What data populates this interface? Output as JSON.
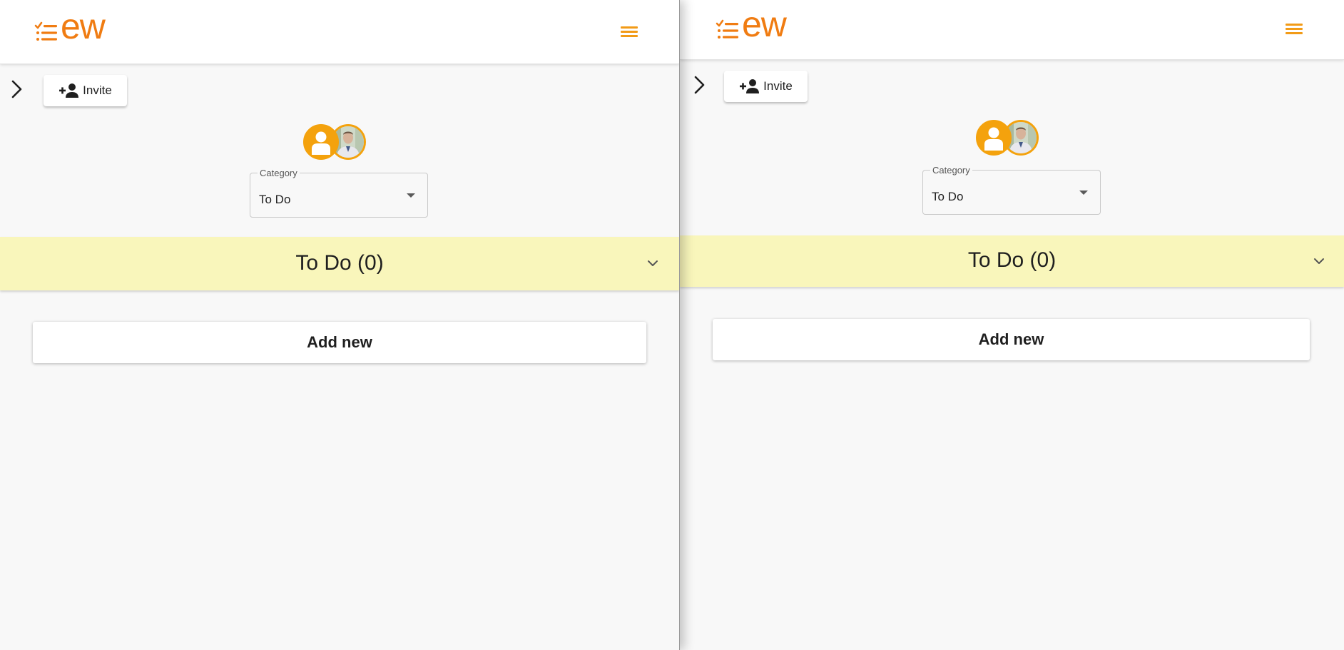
{
  "brand": {
    "logo_text": "ew",
    "logo_color": "#f07c12",
    "accent": "#f4a20d"
  },
  "left_pane": {
    "menu_icon": "hamburger-menu-icon",
    "sidebar_toggle_icon": "chevron-right-icon",
    "invite_label": "Invite",
    "invite_icon": "person-add-icon",
    "avatars": [
      {
        "type": "default-user",
        "icon": "user-icon"
      },
      {
        "type": "photo",
        "icon": "user-photo"
      }
    ],
    "category": {
      "legend": "Category",
      "value": "To Do"
    },
    "section": {
      "title": "To Do (0)",
      "color": "#f9f6bb",
      "expand_icon": "chevron-down-icon"
    },
    "add_new_label": "Add new"
  },
  "right_pane": {
    "menu_icon": "hamburger-menu-icon",
    "sidebar_toggle_icon": "chevron-right-icon",
    "invite_label": "Invite",
    "invite_icon": "person-add-icon",
    "avatars": [
      {
        "type": "default-user",
        "icon": "user-icon"
      },
      {
        "type": "photo",
        "icon": "user-photo"
      }
    ],
    "category": {
      "legend": "Category",
      "value": "To Do"
    },
    "section": {
      "title": "To Do (0)",
      "color": "#f9f6bb",
      "expand_icon": "chevron-down-icon"
    },
    "add_new_label": "Add new"
  }
}
